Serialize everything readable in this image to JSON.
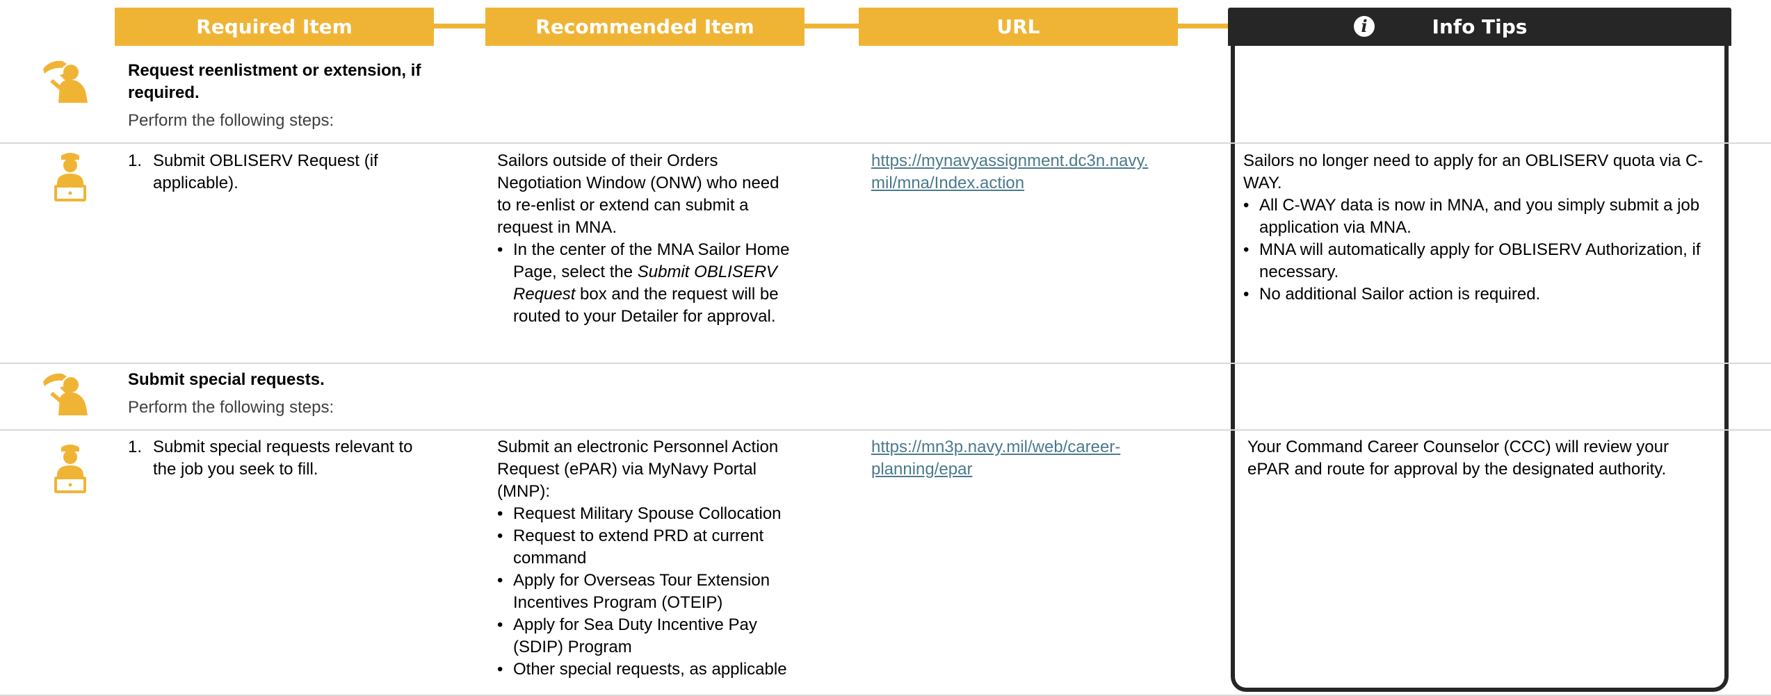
{
  "header": {
    "required_item": "Required Item",
    "recommended_item": "Recommended Item",
    "url": "URL",
    "info_tips": "Info Tips",
    "info_glyph": "i"
  },
  "icons": {
    "salute": "saluting-sailor-icon",
    "laptop": "sailor-at-laptop-icon",
    "info": "info-icon"
  },
  "colors": {
    "accent": "#f0b435",
    "dark": "#262626",
    "link": "#4a7a8c"
  },
  "section1": {
    "title": "Request reenlistment or extension, if required.",
    "subtitle": "Perform the following steps:",
    "step": {
      "number": "1.",
      "text": "Submit OBLISERV Request (if applicable).",
      "recommended_intro": "Sailors outside of their Orders Negotiation Window (ONW) who need to re-enlist or extend can submit a request in MNA.",
      "recommended_bullet_before": "In the center of the MNA Sailor Home Page, select the ",
      "recommended_bullet_italic": "Submit OBLISERV Request",
      "recommended_bullet_after": " box and the request will be routed to your Detailer for approval.",
      "url_line1": "https://mynavyassignment.dc3n.navy.",
      "url_line2": "mil/mna/Index.action",
      "tips_intro": "Sailors no longer need to apply for an OBLISERV quota via C-WAY.",
      "tips_bullets": [
        "All C-WAY data is now in MNA, and you simply submit a job application via MNA.",
        "MNA will automatically apply for OBLISERV Authorization, if necessary.",
        "No additional Sailor action is required."
      ]
    }
  },
  "section2": {
    "title": "Submit special requests.",
    "subtitle": "Perform the following steps:",
    "step": {
      "number": "1.",
      "text": "Submit special requests relevant to the job you seek to fill.",
      "recommended_intro": "Submit an electronic Personnel Action Request (ePAR) via MyNavy Portal (MNP):",
      "recommended_bullets": [
        "Request Military Spouse Collocation",
        "Request to extend PRD at current command",
        "Apply for Overseas Tour Extension Incentives Program (OTEIP)",
        "Apply for Sea Duty Incentive Pay (SDIP) Program",
        "Other special requests, as applicable"
      ],
      "url_line1": "https://mn3p.navy.mil/web/career-",
      "url_line2": "planning/epar",
      "tips_text": "Your Command Career Counselor (CCC) will review your ePAR and route for approval by the designated authority."
    }
  }
}
